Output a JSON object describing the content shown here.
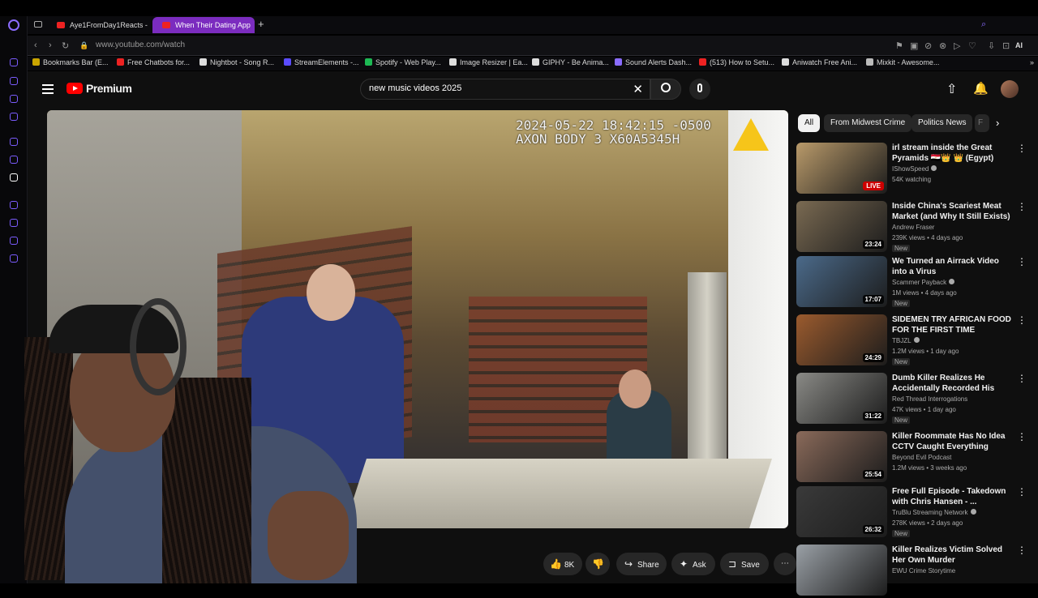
{
  "browser": {
    "tabs": [
      {
        "label": "Aye1FromDay1Reacts - Yo"
      },
      {
        "label": "When Their Dating App",
        "active": true
      }
    ],
    "url": "www.youtube.com/watch",
    "bookmarks": [
      {
        "label": "Bookmarks Bar (E...",
        "icon": "folder-icon",
        "color": "#c9a400"
      },
      {
        "label": "Free Chatbots for...",
        "icon": "youtube-icon",
        "color": "#e22"
      },
      {
        "label": "Nightbot - Song R...",
        "icon": "nightbot-icon",
        "color": "#ddd"
      },
      {
        "label": "StreamElements -...",
        "icon": "streamelements-icon",
        "color": "#5b4cff"
      },
      {
        "label": "Spotify - Web Play...",
        "icon": "spotify-icon",
        "color": "#1db954"
      },
      {
        "label": "Image Resizer | Ea...",
        "icon": "image-resizer-icon",
        "color": "#ddd"
      },
      {
        "label": "GIPHY - Be Anima...",
        "icon": "giphy-icon",
        "color": "#ddd"
      },
      {
        "label": "Sound Alerts Dash...",
        "icon": "sound-alerts-icon",
        "color": "#8a6cff"
      },
      {
        "label": "(513) How to Setu...",
        "icon": "youtube-icon",
        "color": "#e22"
      },
      {
        "label": "Aniwatch Free Ani...",
        "icon": "aniwatch-icon",
        "color": "#ddd"
      },
      {
        "label": "Mixkit - Awesome...",
        "icon": "mixkit-icon",
        "color": "#bbb"
      }
    ]
  },
  "youtube": {
    "logo_text": "Premium",
    "search_query": "new music videos 2025",
    "video": {
      "timestamp_line1": "2024-05-22 18:42:15 -0500",
      "timestamp_line2": "AXON BODY 3 X60A5345H"
    },
    "actions": {
      "like_count": "8K",
      "share": "Share",
      "ask": "Ask",
      "save": "Save"
    },
    "chips": [
      "All",
      "From Midwest Crime",
      "Politics News",
      "F"
    ],
    "suggestions": [
      {
        "title": "irl stream inside the Great Pyramids 🇪🇬👑 👑 (Egypt)",
        "channel": "IShowSpeed",
        "verified": true,
        "meta": "54K watching",
        "badge": "LIVE",
        "new": false,
        "thumb": "#b99a6a"
      },
      {
        "title": "Inside China's Scariest Meat Market (and Why It Still Exists)",
        "channel": "Andrew Fraser",
        "verified": false,
        "meta": "239K views • 4 days ago",
        "badge": "23:24",
        "new": true,
        "thumb": "#7a6a52"
      },
      {
        "title": "We Turned an Airrack Video into a Virus",
        "channel": "Scammer Payback",
        "verified": true,
        "meta": "1M views • 4 days ago",
        "badge": "17:07",
        "new": true,
        "thumb": "#4b6a8a"
      },
      {
        "title": "SIDEMEN TRY AFRICAN FOOD FOR THE FIRST TIME",
        "channel": "TBJZL",
        "verified": true,
        "meta": "1.2M views • 1 day ago",
        "badge": "24:29",
        "new": true,
        "thumb": "#9b5b2e"
      },
      {
        "title": "Dumb Killer Realizes He Accidentally Recorded His Ow...",
        "channel": "Red Thread Interrogations",
        "verified": false,
        "meta": "47K views • 1 day ago",
        "badge": "31:22",
        "new": true,
        "thumb": "#8a8a86"
      },
      {
        "title": "Killer Roommate Has No Idea CCTV Caught Everything",
        "channel": "Beyond Evil Podcast",
        "verified": false,
        "meta": "1.2M views • 3 weeks ago",
        "badge": "25:54",
        "new": false,
        "thumb": "#8a6a5a"
      },
      {
        "title": "Free Full Episode - Takedown with Chris Hansen - ...",
        "channel": "TruBlu Streaming Network",
        "verified": true,
        "meta": "278K views • 2 days ago",
        "badge": "26:32",
        "new": true,
        "thumb": "#3a3a3a"
      },
      {
        "title": "Killer Realizes Victim Solved Her Own Murder",
        "channel": "EWU Crime Storytime",
        "verified": false,
        "meta": "",
        "badge": "",
        "new": false,
        "thumb": "#9aa0a6"
      }
    ]
  }
}
